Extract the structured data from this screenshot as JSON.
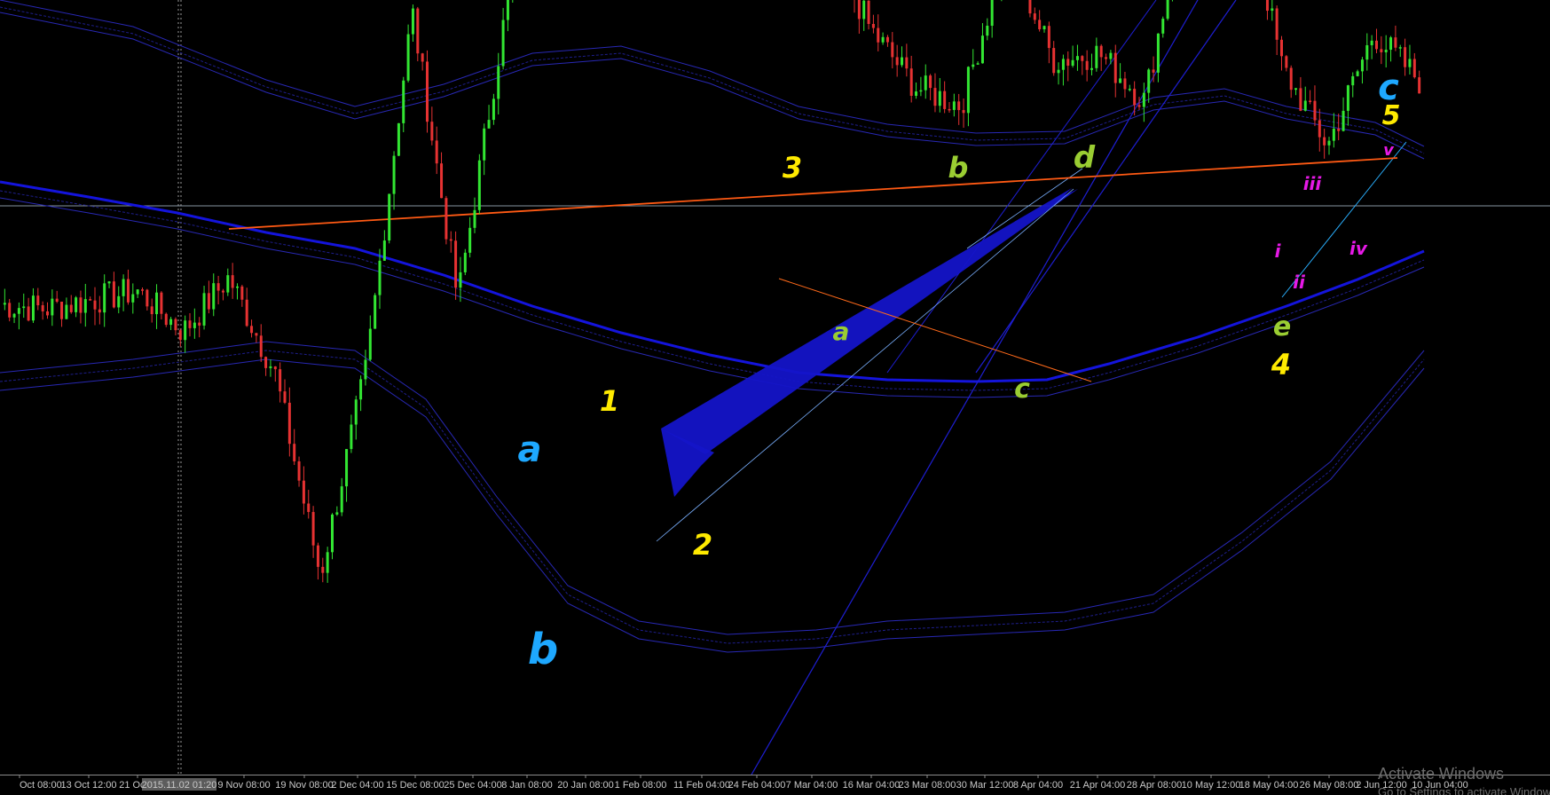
{
  "chart_data": {
    "type": "line",
    "chart_style": "candlestick",
    "title": "",
    "xlabel": "",
    "ylabel": "",
    "grid": false,
    "legend": "none",
    "background": "#000000",
    "x_ticks": [
      "Oct 08:00",
      "13 Oct 12:00",
      "21 Oct 0",
      "9 Nov 08:00",
      "19 Nov 08:00",
      "2 Dec 04:00",
      "15 Dec 08:00",
      "25 Dec 04:00",
      "8 Jan 08:00",
      "20 Jan 08:00",
      "1 Feb 08:00",
      "11 Feb 04:00",
      "24 Feb 04:00",
      "7 Mar 04:00",
      "16 Mar 04:00",
      "23 Mar 08:00",
      "30 Mar 12:00",
      "8 Apr 04:00",
      "21 Apr 04:00",
      "28 Apr 08:00",
      "10 May 12:00",
      "18 May 04:00",
      "26 May 08:00",
      "2 Jun 12:00",
      "10 Jun 04:00"
    ],
    "crosshair_label": "2015.11.02 01:20",
    "price_path": [
      [
        0,
        140
      ],
      [
        1,
        138
      ],
      [
        2,
        142
      ],
      [
        3,
        146
      ],
      [
        4,
        128
      ],
      [
        5,
        152
      ],
      [
        6,
        110
      ],
      [
        7,
        20
      ],
      [
        8,
        112
      ],
      [
        9,
        270
      ],
      [
        10,
        142
      ],
      [
        11,
        264
      ],
      [
        12,
        395
      ],
      [
        13,
        310
      ],
      [
        14,
        342
      ],
      [
        15,
        380
      ],
      [
        16,
        356
      ],
      [
        17,
        350
      ],
      [
        18,
        305
      ],
      [
        19,
        262
      ],
      [
        20,
        236
      ],
      [
        21,
        228
      ],
      [
        22,
        298
      ],
      [
        23,
        248
      ],
      [
        24,
        251
      ],
      [
        25,
        230
      ],
      [
        26,
        328
      ],
      [
        27,
        338
      ],
      [
        28,
        245
      ],
      [
        29,
        210
      ],
      [
        30,
        260
      ],
      [
        31,
        239
      ]
    ],
    "bands": {
      "upper_outer_color": "#2828b4",
      "upper_inner_color": "#1e1e8c",
      "mid_color": "#1414dc",
      "lower_outer_color": "#2828b4",
      "lower_inner_color": "#1e1e8c"
    },
    "candle_colors": {
      "bull": "#32e632",
      "bear": "#e63232"
    },
    "wave_labels": [
      {
        "text": "a",
        "color": "#1ea8ff"
      },
      {
        "text": "b",
        "color": "#1ea8ff"
      },
      {
        "text": "c",
        "color": "#1ea8ff"
      },
      {
        "text": "1",
        "color": "#ffea00"
      },
      {
        "text": "2",
        "color": "#ffea00"
      },
      {
        "text": "3",
        "color": "#ffea00"
      },
      {
        "text": "4",
        "color": "#ffea00"
      },
      {
        "text": "5",
        "color": "#ffea00"
      },
      {
        "text": "a",
        "color": "#9acd32"
      },
      {
        "text": "b",
        "color": "#9acd32"
      },
      {
        "text": "c",
        "color": "#9acd32"
      },
      {
        "text": "d",
        "color": "#9acd32"
      },
      {
        "text": "e",
        "color": "#9acd32"
      },
      {
        "text": "i",
        "color": "#e619e6"
      },
      {
        "text": "ii",
        "color": "#e619e6"
      },
      {
        "text": "iii",
        "color": "#e619e6"
      },
      {
        "text": "iv",
        "color": "#e619e6"
      },
      {
        "text": "v",
        "color": "#e619e6"
      }
    ],
    "trendline_colors": {
      "resistance": "#ff5a14",
      "channel": "#1e1ed2",
      "triangle_fill": "#1414c8"
    }
  },
  "watermark": {
    "line1": "Activate Windows",
    "line2": "Go to Settings to activate Windows."
  }
}
